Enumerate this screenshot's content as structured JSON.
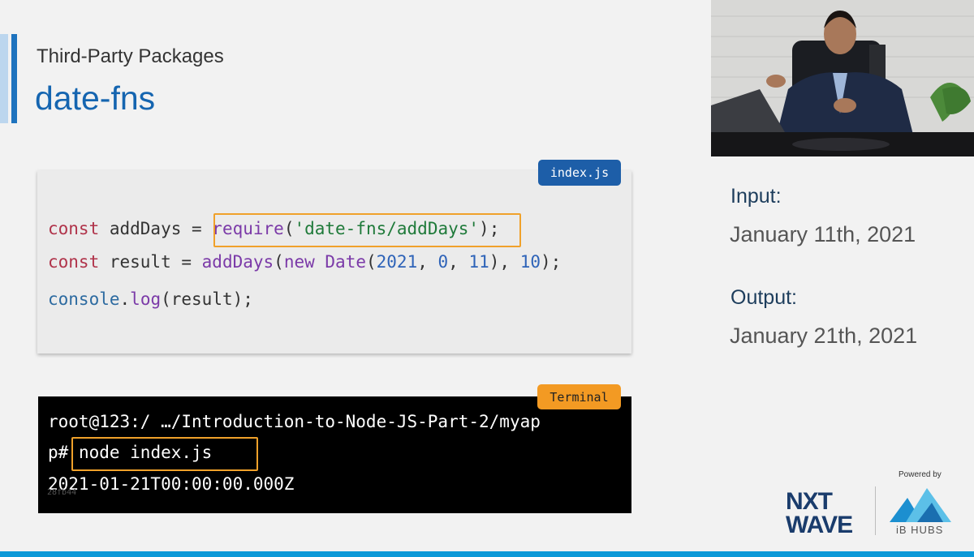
{
  "slide": {
    "subtitle": "Third-Party Packages",
    "title": "date-fns"
  },
  "code_panel": {
    "tab": "index.js",
    "line1": {
      "kw": "const",
      "name": " addDays = ",
      "fn": "require",
      "open": "(",
      "str": "'date-fns/addDays'",
      "close": ");"
    },
    "line2": {
      "kw": "const",
      "name": " result = ",
      "fn": "addDays",
      "p1": "(",
      "kw2": "new",
      "fn2": " Date",
      "p2": "(",
      "n1": "2021",
      "c1": ", ",
      "n2": "0",
      "c2": ", ",
      "n3": "11",
      "p3": "), ",
      "n4": "10",
      "end": ");"
    },
    "line3": {
      "obj": "console",
      "dot": ".",
      "fn": "log",
      "rest": "(result);"
    }
  },
  "terminal": {
    "tab": "Terminal",
    "line1": "root@123:/ …/Introduction-to-Node-JS-Part-2/myap",
    "line2_prompt": "p#",
    "line2_cmd": " node index.js",
    "line3": "2021-01-21T00:00:00.000Z",
    "id": "28fb44"
  },
  "side": {
    "input_label": "Input:",
    "input_value": "January 11th, 2021",
    "output_label": "Output:",
    "output_value": "January 21th, 2021"
  },
  "branding": {
    "nxt_line1": "NXT",
    "nxt_line2": "WAVE",
    "powered_by": "Powered by",
    "ib_hubs": "iB HUBS"
  },
  "colors": {
    "accent": "#1565b0",
    "highlight": "#f0a12a",
    "terminal_tag": "#f39a23"
  }
}
